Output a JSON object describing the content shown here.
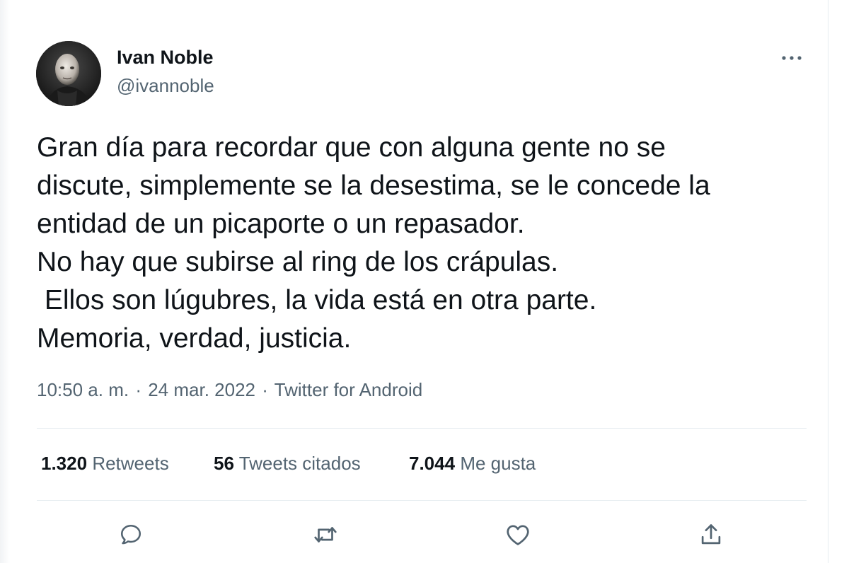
{
  "author": {
    "display_name": "Ivan Noble",
    "handle": "@ivannoble"
  },
  "tweet": {
    "lines": [
      "Gran día para recordar que con alguna gente no se",
      "discute, simplemente se la desestima, se le concede la",
      "entidad de un picaporte o un repasador.",
      "No hay que subirse al ring de los crápulas.",
      " Ellos son lúgubres, la vida está en otra parte.",
      "Memoria, verdad, justicia."
    ],
    "time": "10:50 a. m.",
    "separator": "·",
    "date": "24 mar. 2022",
    "source": "Twitter for Android"
  },
  "stats": {
    "retweets_count": "1.320",
    "retweets_label": "Retweets",
    "quotes_count": "56",
    "quotes_label": "Tweets citados",
    "likes_count": "7.044",
    "likes_label": "Me gusta"
  },
  "icons": {
    "more": "more-horizontal-icon",
    "reply": "reply-icon",
    "retweet": "retweet-icon",
    "like": "heart-icon",
    "share": "share-icon"
  },
  "colors": {
    "text_primary": "#0f1419",
    "text_secondary": "#536471",
    "divider": "#e6ecf0"
  }
}
